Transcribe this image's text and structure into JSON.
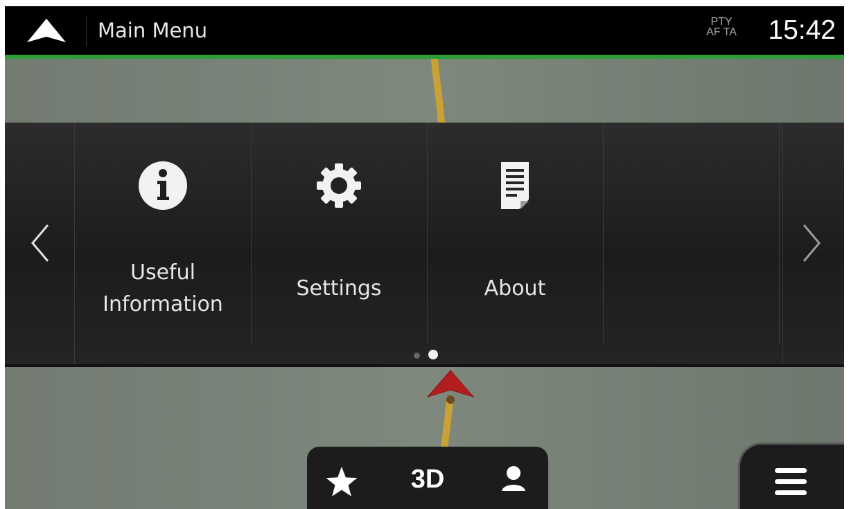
{
  "header": {
    "title": "Main Menu",
    "rds_line1": "PTY",
    "rds_line2": "AF TA",
    "clock": "15:42",
    "nav_icon": "navigation-arrow-icon",
    "accent_color": "#2e9d3a"
  },
  "menu": {
    "tiles": [
      {
        "label": "Useful\nInformation",
        "icon": "info-icon"
      },
      {
        "label": "Settings",
        "icon": "gear-icon"
      },
      {
        "label": "About",
        "icon": "document-icon"
      },
      {
        "label": "",
        "icon": ""
      }
    ],
    "prev_icon": "chevron-left-icon",
    "next_icon": "chevron-right-icon",
    "page_index": 2,
    "page_count": 2
  },
  "bottom": {
    "favorite_icon": "star-icon",
    "view_mode": "3D",
    "poi_icon": "person-pin-icon",
    "menu_icon": "hamburger-icon"
  },
  "map": {
    "background_color": "#7a8479",
    "road_color": "#c9a233",
    "position_marker_color": "#b21e1e"
  }
}
